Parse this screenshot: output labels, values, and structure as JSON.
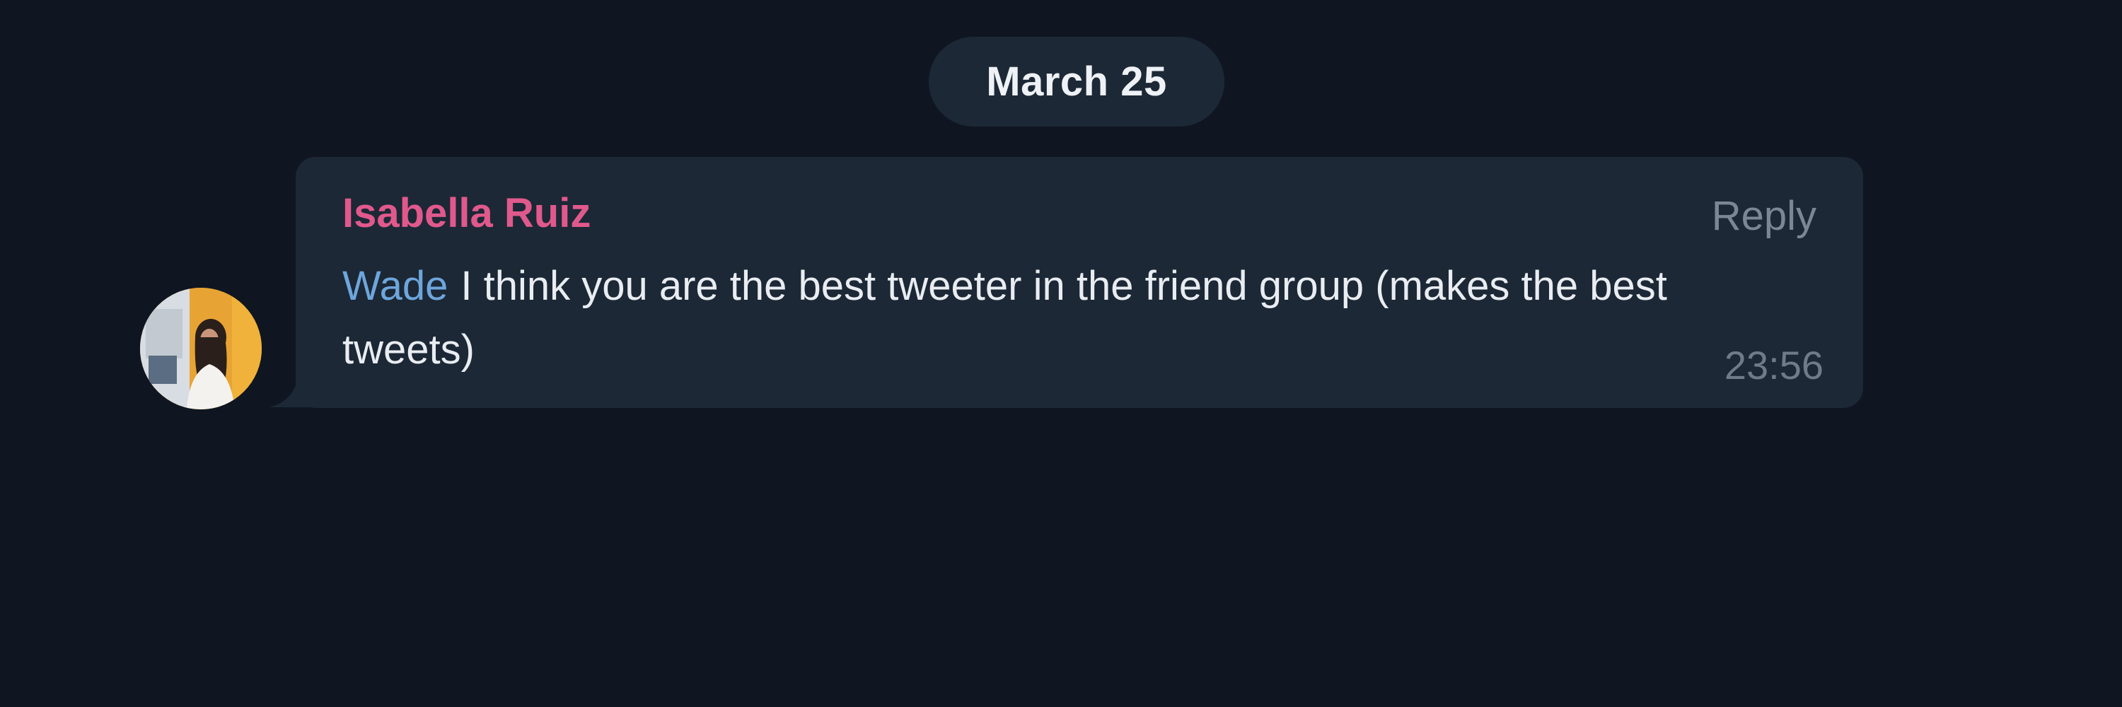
{
  "date_separator": "March 25",
  "message": {
    "sender": "Isabella Ruiz",
    "reply_label": "Reply",
    "mention": "Wade",
    "text": "I think you are the best tweeter in the friend group (makes the best tweets)",
    "time": "23:56",
    "avatar_icon": "user-avatar-photo"
  },
  "colors": {
    "background": "#0f1621",
    "bubble": "#1c2836",
    "sender_name": "#e1598c",
    "mention": "#6ea6dc",
    "muted_text": "#7b8795",
    "message_text": "#e9edf2"
  }
}
